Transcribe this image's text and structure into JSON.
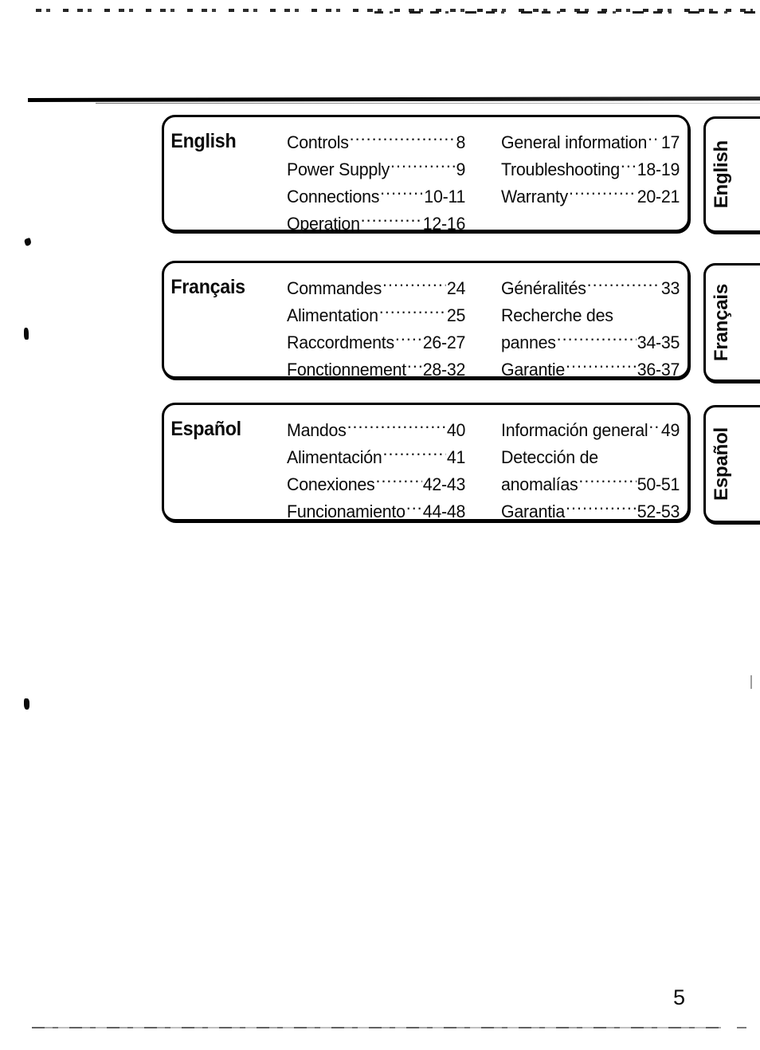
{
  "page": {
    "number": "5"
  },
  "sections": [
    {
      "id": "english",
      "language": "English",
      "tab_label": "English",
      "columns": [
        [
          {
            "label": "Controls",
            "pages": "8"
          },
          {
            "label": "Power Supply",
            "pages": "9"
          },
          {
            "label": "Connections",
            "pages": "10-11"
          },
          {
            "label": "Operation",
            "pages": "12-16"
          }
        ],
        [
          {
            "label": "General information",
            "pages": "17"
          },
          {
            "label": "Troubleshooting",
            "pages": "18-19"
          },
          {
            "label": "Warranty",
            "pages": "20-21"
          }
        ]
      ]
    },
    {
      "id": "francais",
      "language": "Français",
      "tab_label": "Français",
      "columns": [
        [
          {
            "label": "Commandes",
            "pages": "24"
          },
          {
            "label": "Alimentation",
            "pages": "25"
          },
          {
            "label": "Raccordments",
            "pages": "26-27"
          },
          {
            "label": "Fonctionnement",
            "pages": "28-32"
          }
        ],
        [
          {
            "label": "Généralités",
            "pages": "33"
          },
          {
            "label": "Recherche des",
            "pages": "",
            "leader": false
          },
          {
            "label": "pannes",
            "pages": "34-35"
          },
          {
            "label": "Garantie",
            "pages": "36-37"
          }
        ]
      ]
    },
    {
      "id": "espanol",
      "language": "Español",
      "tab_label": "Español",
      "columns": [
        [
          {
            "label": "Mandos",
            "pages": "40"
          },
          {
            "label": "Alimentación",
            "pages": "41"
          },
          {
            "label": "Conexiones",
            "pages": "42-43"
          },
          {
            "label": "Funcionamiento",
            "pages": "44-48"
          }
        ],
        [
          {
            "label": "Información general",
            "pages": "49"
          },
          {
            "label": "Detección de",
            "pages": "",
            "leader": false
          },
          {
            "label": "anomalías",
            "pages": "50-51"
          },
          {
            "label": "Garantia",
            "pages": "52-53"
          }
        ]
      ]
    }
  ]
}
